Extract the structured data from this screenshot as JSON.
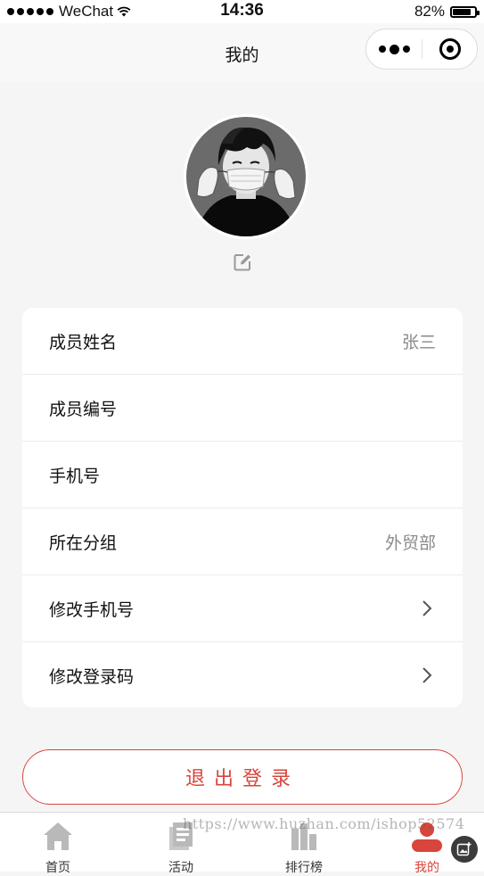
{
  "status_bar": {
    "carrier": "WeChat",
    "time": "14:36",
    "battery_percent": "82%",
    "battery_level": 0.82
  },
  "nav": {
    "title": "我的"
  },
  "profile": {
    "avatar_icon": "user-avatar-photo",
    "edit_icon": "edit-icon"
  },
  "info_rows": [
    {
      "label": "成员姓名",
      "value": "张三",
      "arrow": false
    },
    {
      "label": "成员编号",
      "value": "",
      "arrow": false
    },
    {
      "label": "手机号",
      "value": "",
      "arrow": false
    },
    {
      "label": "所在分组",
      "value": "外贸部",
      "arrow": false
    },
    {
      "label": "修改手机号",
      "value": "",
      "arrow": true
    },
    {
      "label": "修改登录码",
      "value": "",
      "arrow": true
    }
  ],
  "logout": {
    "label": "退出登录"
  },
  "tabs": [
    {
      "label": "首页",
      "icon": "home-icon",
      "active": false
    },
    {
      "label": "活动",
      "icon": "document-icon",
      "active": false
    },
    {
      "label": "排行榜",
      "icon": "ranking-icon",
      "active": false
    },
    {
      "label": "我的",
      "icon": "profile-icon",
      "active": true
    }
  ],
  "watermark": "https://www.huzhan.com/ishop52574",
  "colors": {
    "accent": "#d9443b",
    "background": "#f5f5f5",
    "value_gray": "#8a8a8a"
  }
}
